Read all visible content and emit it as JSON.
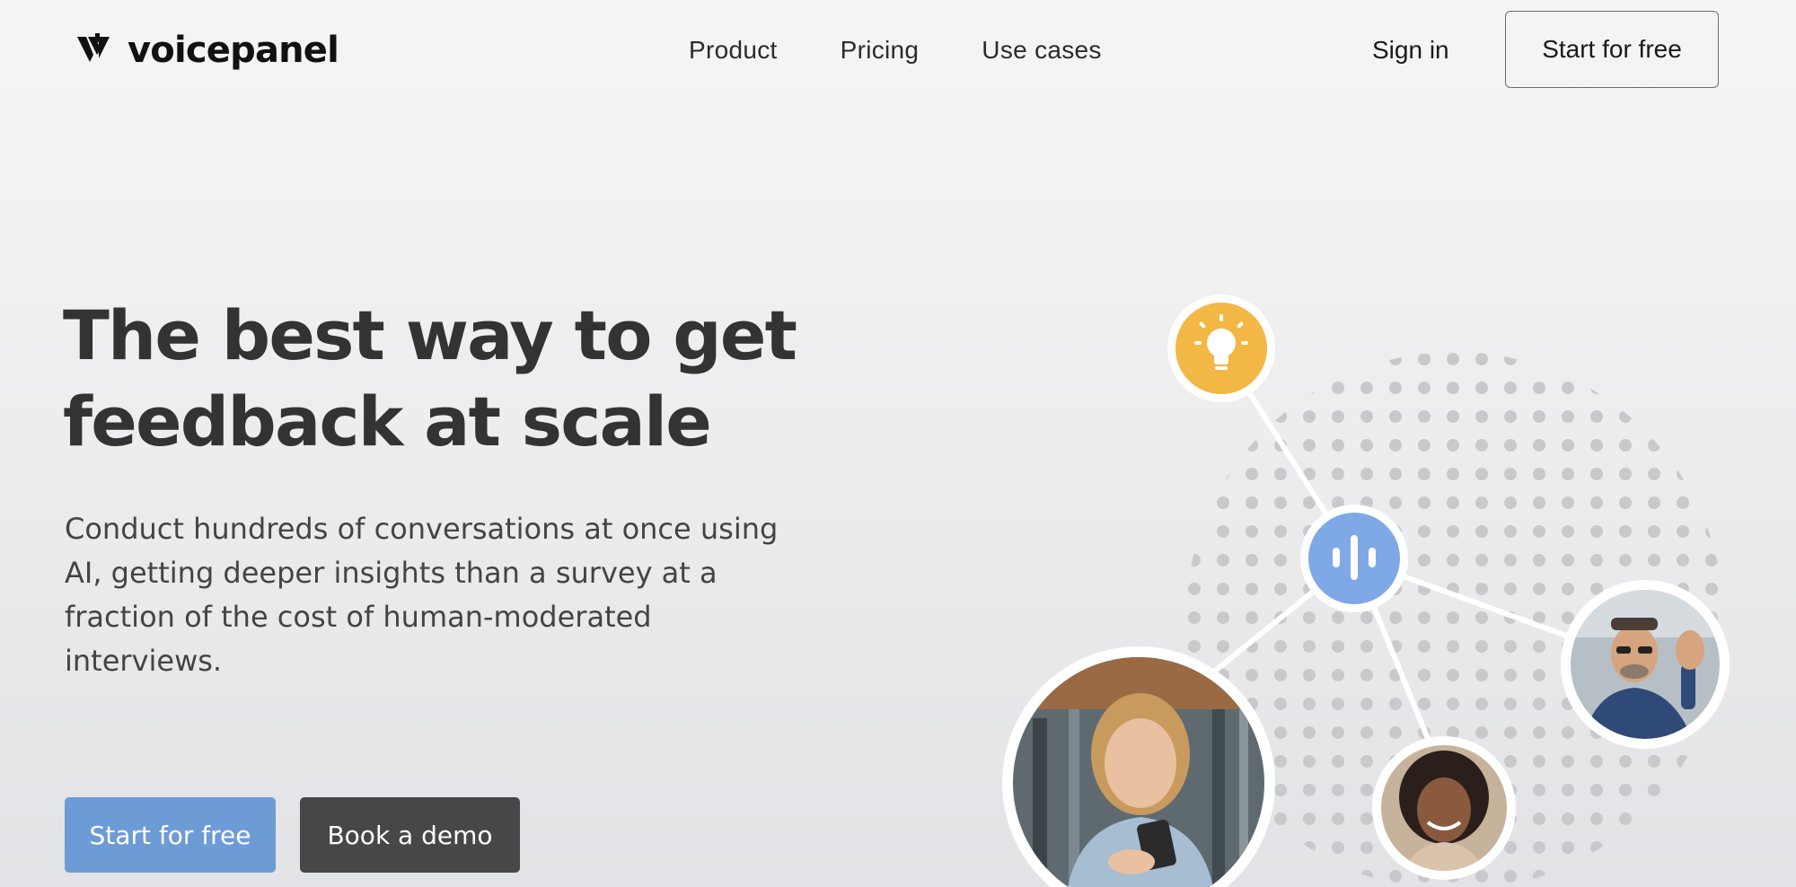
{
  "header": {
    "brand": "voicepanel",
    "nav": [
      {
        "label": "Product"
      },
      {
        "label": "Pricing"
      },
      {
        "label": "Use cases"
      }
    ],
    "sign_in": "Sign in",
    "cta": "Start for free"
  },
  "hero": {
    "title": "The best way to get feedback at scale",
    "subtitle": "Conduct hundreds of conversations at once using AI, getting deeper insights than a survey at a fraction of the cost of human-moderated interviews.",
    "primary_button": "Start for free",
    "secondary_button": "Book a demo"
  },
  "illustration": {
    "nodes": [
      {
        "name": "lightbulb-icon",
        "color": "#f2b744"
      },
      {
        "name": "voice-waveform-icon",
        "color": "#7fa9e6"
      },
      {
        "name": "avatar-woman-with-phone"
      },
      {
        "name": "avatar-woman-curly-hair"
      },
      {
        "name": "avatar-man-waving"
      }
    ],
    "colors": {
      "dot": "#c8c9cc",
      "connector": "#ffffff",
      "ring": "#ffffff"
    }
  },
  "colors": {
    "primary_button": "#6d9bd6",
    "dark_button": "#474747",
    "headline": "#333333"
  }
}
